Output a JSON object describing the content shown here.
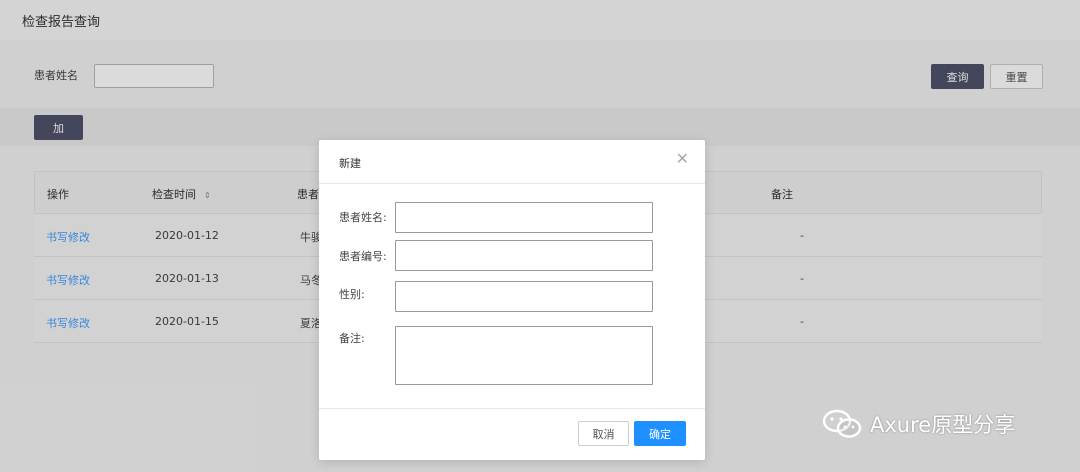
{
  "page": {
    "title": "检查报告查询"
  },
  "search": {
    "label": "患者姓名",
    "value": "",
    "query_label": "查询",
    "reset_label": "重置"
  },
  "actions": {
    "add_label": "加"
  },
  "table": {
    "columns": [
      "操作",
      "检查时间",
      "患者",
      "备注"
    ],
    "rows": [
      {
        "action": "书写修改",
        "time": "2020-01-12",
        "patient": "牛骏",
        "note": "-"
      },
      {
        "action": "书写修改",
        "time": "2020-01-13",
        "patient": "马冬",
        "note": "-"
      },
      {
        "action": "书写修改",
        "time": "2020-01-15",
        "patient": "夏洛",
        "note": "-"
      }
    ]
  },
  "modal": {
    "title": "新建",
    "fields": [
      {
        "label": "患者姓名:",
        "value": ""
      },
      {
        "label": "患者编号:",
        "value": ""
      },
      {
        "label": "性别:",
        "value": ""
      },
      {
        "label": "备注:",
        "value": ""
      }
    ],
    "cancel_label": "取消",
    "ok_label": "确定"
  },
  "watermark": {
    "text": "Axure原型分享"
  },
  "icons": {
    "close": "close-icon",
    "sort": "sort-icon",
    "wechat": "wechat-icon"
  },
  "colors": {
    "primary_dark": "#50536c",
    "primary_blue": "#1e90ff",
    "link": "#409eff"
  }
}
